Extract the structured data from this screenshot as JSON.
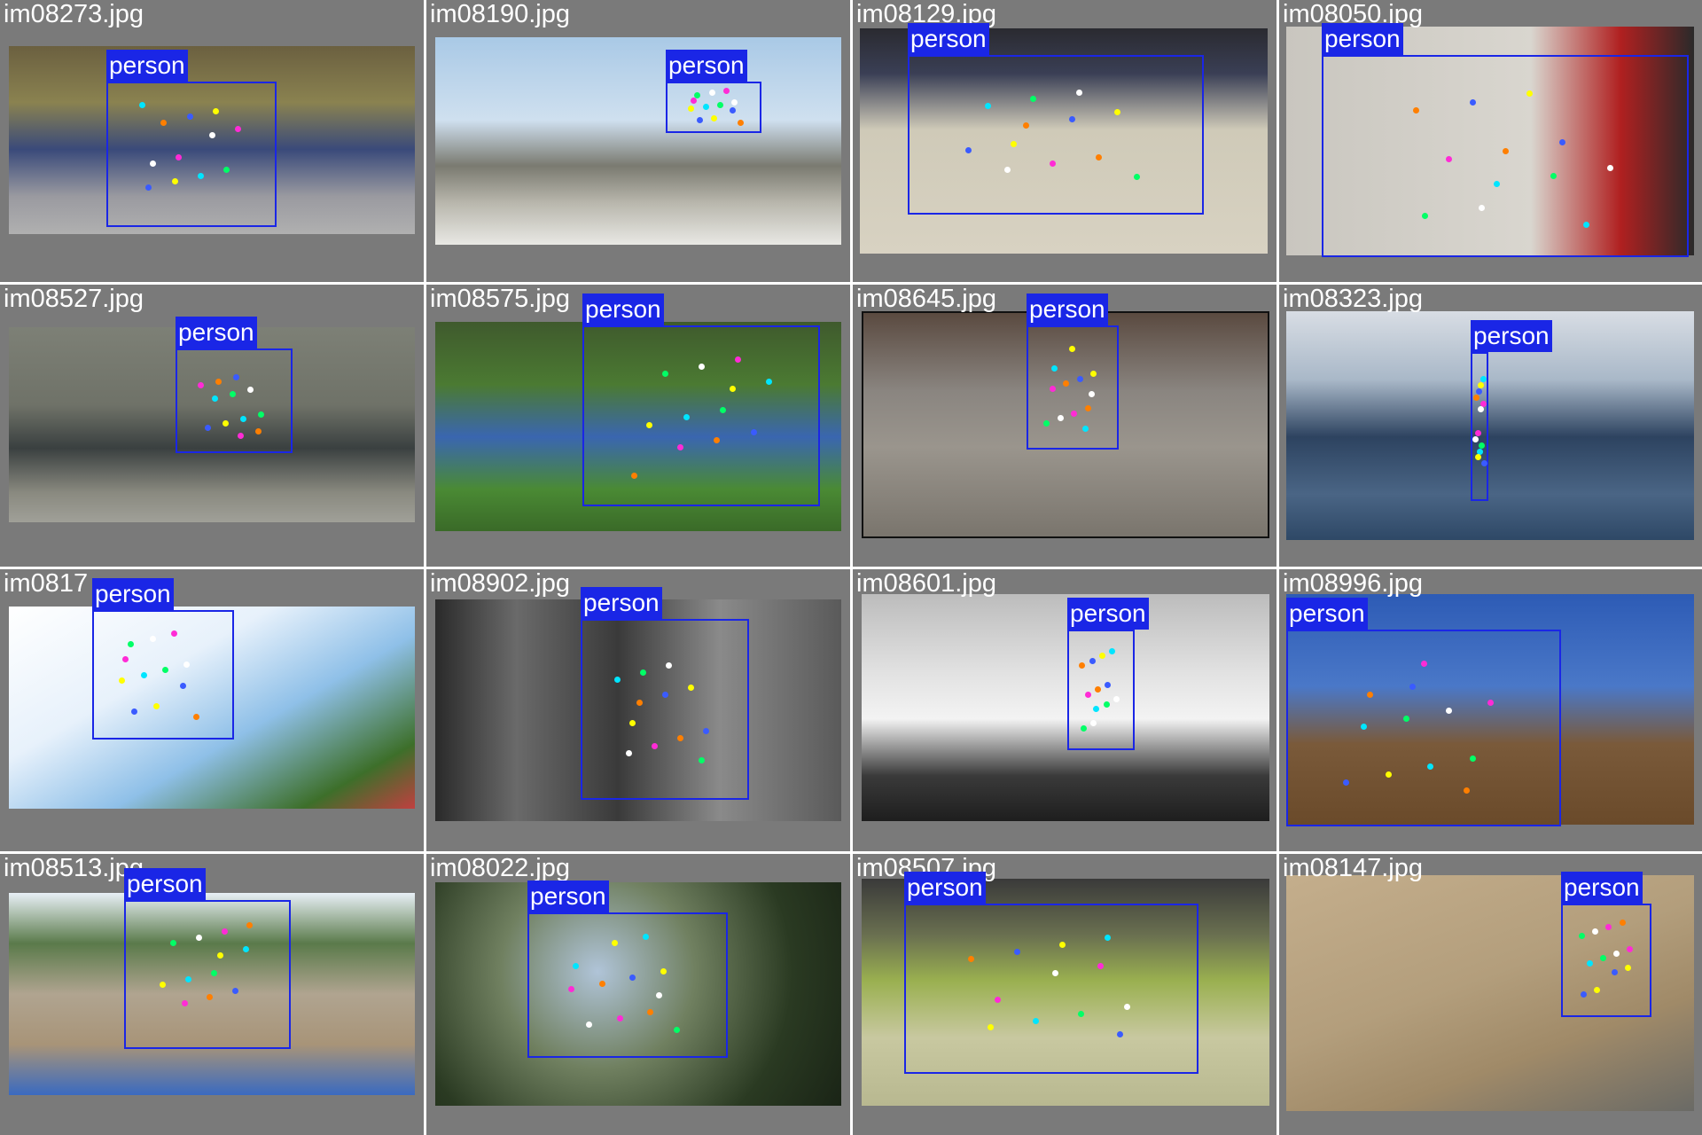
{
  "image_title": "",
  "cells": [
    {
      "file": "im08273.jpg",
      "label": "person"
    },
    {
      "file": "im08190.jpg",
      "label": "person"
    },
    {
      "file": "im08129.jpg",
      "label": "person"
    },
    {
      "file": "im08050.jpg",
      "label": "person"
    },
    {
      "file": "im08527.jpg",
      "label": "person"
    },
    {
      "file": "im08575.jpg",
      "label": "person"
    },
    {
      "file": "im08645.jpg",
      "label": "person"
    },
    {
      "file": "im08323.jpg",
      "label": "person"
    },
    {
      "file": "im0817",
      "label": "person"
    },
    {
      "file": "im08902.jpg",
      "label": "person"
    },
    {
      "file": "im08601.jpg",
      "label": "person"
    },
    {
      "file": "im08996.jpg",
      "label": "person"
    },
    {
      "file": "im08513.jpg",
      "label": "person"
    },
    {
      "file": "im08022.jpg",
      "label": "person"
    },
    {
      "file": "im08507.jpg",
      "label": "person"
    },
    {
      "file": "im08147.jpg",
      "label": "person"
    }
  ],
  "colors": {
    "cell_background": "#7a7a7a",
    "box": "#1a26e6",
    "label_text": "#ffffff",
    "keypoints": [
      "#00e5ff",
      "#ff2bd6",
      "#ffff00",
      "#ffffff",
      "#3a5bff",
      "#00ff66",
      "#ff7f00"
    ]
  }
}
